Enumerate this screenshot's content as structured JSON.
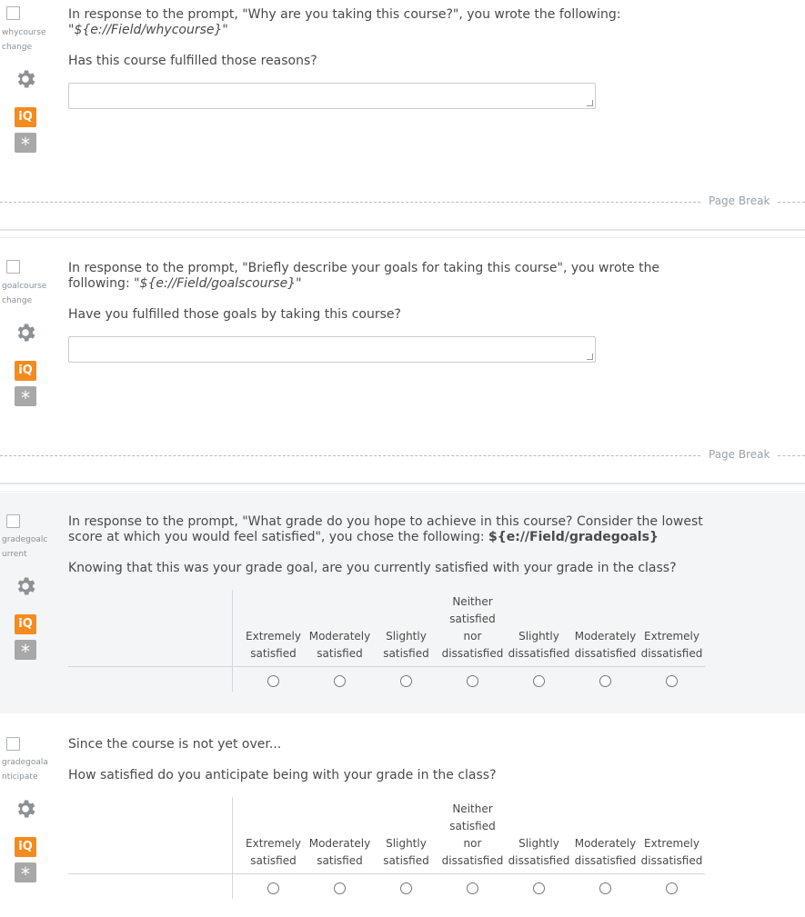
{
  "page_break_label": "Page Break",
  "icons": {
    "settings": "gear-icon",
    "iq": "iq-icon",
    "required": "asterisk-icon",
    "iq_label": "iQ",
    "required_label": "*"
  },
  "colors": {
    "iq_orange": "#f48b1f",
    "required_gray": "#a8a8a8",
    "highlight_bg": "#f4f5f6"
  },
  "scale_columns": [
    [
      "",
      "",
      "Extremely",
      "satisfied"
    ],
    [
      "",
      "",
      "Moderately",
      "satisfied"
    ],
    [
      "",
      "",
      "Slightly",
      "satisfied"
    ],
    [
      "Neither",
      "satisfied",
      "nor",
      "dissatisfied"
    ],
    [
      "",
      "",
      "Slightly",
      "dissatisfied"
    ],
    [
      "",
      "",
      "Moderately",
      "dissatisfied"
    ],
    [
      "",
      "",
      "Extremely",
      "dissatisfied"
    ]
  ],
  "questions": [
    {
      "id_label": "whycourse change",
      "text_before": "In response to the prompt, \"Why are you taking this course?\", you wrote the following: \"",
      "pipe": "${e://Field/whycourse}",
      "text_after": "\"",
      "subtext": "Has this course fulfilled those reasons?",
      "type": "text-entry"
    },
    {
      "id_label": "goalcourse change",
      "text_before": "In response to the prompt, \"Briefly describe your goals for taking this course\", you wrote the following: \"",
      "pipe": "${e://Field/goalscourse}",
      "text_after": "\"",
      "subtext": "Have you fulfilled those goals by taking this course?",
      "type": "text-entry"
    },
    {
      "id_label": "gradegoalc urrent",
      "text_before": "In response to the prompt, \"What grade do you hope to achieve in this course? Consider the lowest score at which you would feel satisfied\", you chose the following: ",
      "pipe": "${e://Field/gradegoals}",
      "text_after": "",
      "subtext": "Knowing that this was your grade goal, are you currently satisfied with your grade in the class?",
      "type": "matrix"
    },
    {
      "id_label": "gradegoala nticipate",
      "text_before": "Since the course is not yet over...",
      "pipe": "",
      "text_after": "",
      "subtext": "How satisfied do you anticipate being with your grade in the class?",
      "type": "matrix"
    }
  ]
}
